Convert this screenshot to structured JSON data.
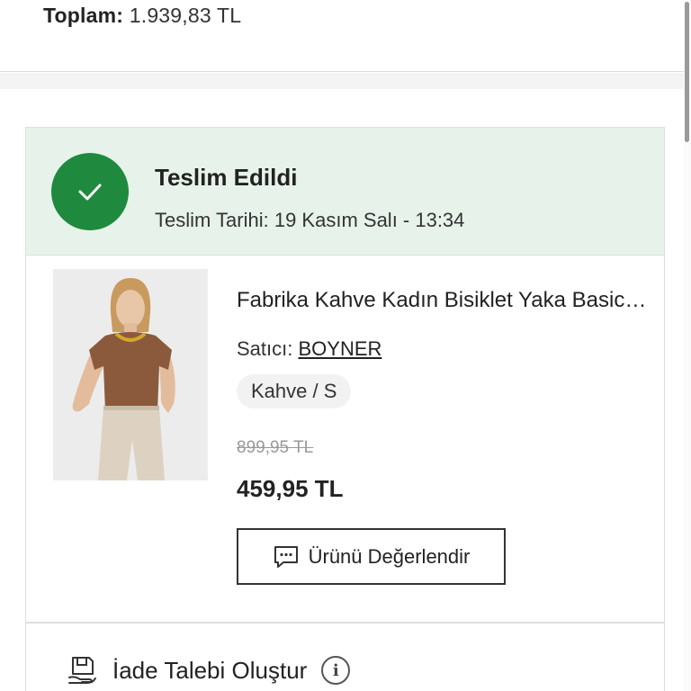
{
  "summary": {
    "total_label": "Toplam:",
    "total_value": "1.939,83 TL"
  },
  "status": {
    "title": "Teslim Edildi",
    "date_text": "Teslim Tarihi: 19 Kasım Salı - 13:34",
    "icon": "check-icon",
    "color": "#1f8a3d",
    "background": "#e7f3ea"
  },
  "product": {
    "title": "Fabrika Kahve Kadın Bisiklet Yaka Basic Tişört",
    "seller_label": "Satıcı:",
    "seller_name": "BOYNER",
    "variant": "Kahve / S",
    "old_price": "899,95 TL",
    "new_price": "459,95 TL",
    "image_icon": "product-photo"
  },
  "actions": {
    "review_label": "Ürünü Değerlendir",
    "review_icon": "chat-bubble-icon",
    "return_label": "İade Talebi Oluştur",
    "return_icon": "return-box-icon",
    "info_icon": "info-icon"
  }
}
